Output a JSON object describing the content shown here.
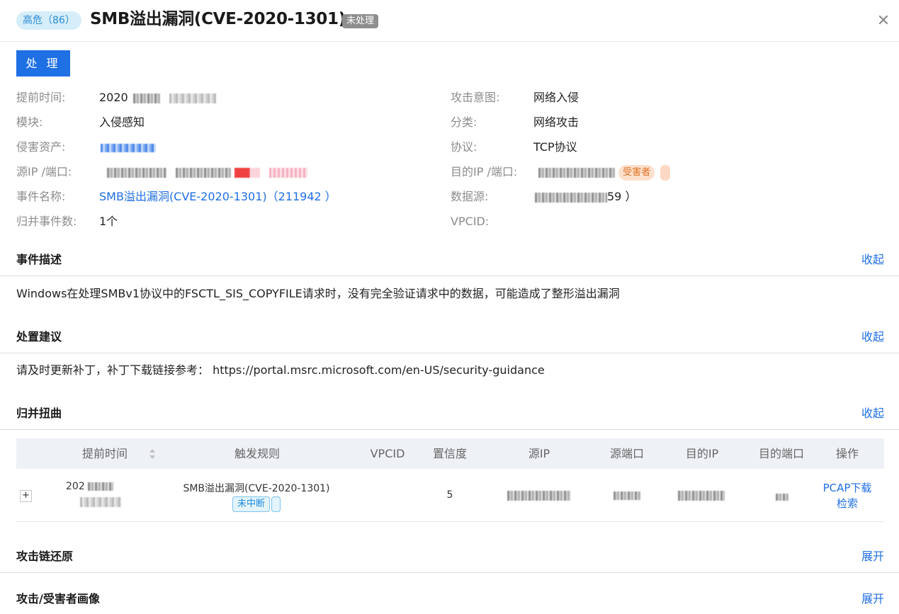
{
  "header": {
    "severity_label": "高危（86）",
    "title": "SMB溢出漏洞(CVE-2020-1301)",
    "status": "未处理",
    "close_glyph": "✕"
  },
  "handle_button": "处 理",
  "fields": {
    "alert_time_label": "提前时间:",
    "alert_time_value": "2020",
    "module_label": "模块:",
    "module_value": "入侵感知",
    "asset_label": "侵害资产:",
    "src_label": "源IP /端口:",
    "event_name_label": "事件名称:",
    "event_name_value": "SMB溢出漏洞(CVE-2020-1301)（211942 ）",
    "merged_count_label": "归并事件数:",
    "merged_count_value": "1个",
    "intent_label": "攻击意图:",
    "intent_value": "网络入侵",
    "category_label": "分类:",
    "category_value": "网络攻击",
    "protocol_label": "协议:",
    "protocol_value": "TCP协议",
    "dst_label": "目的IP /端口:",
    "victim_tag": "受害者",
    "datasource_label": "数据源:",
    "datasource_suffix": "59 ）",
    "vpcid_label": "VPCID:"
  },
  "sections": {
    "description": {
      "title": "事件描述",
      "action": "收起",
      "body": "Windows在处理SMBv1协议中的FSCTL_SIS_COPYFILE请求时，没有完全验证请求中的数据，可能造成了整形溢出漏洞"
    },
    "advice": {
      "title": "处置建议",
      "action": "收起",
      "body": "请及时更新补丁，补丁下载链接参考： https://portal.msrc.microsoft.com/en-US/security-guidance"
    },
    "merged": {
      "title": "归并扭曲",
      "action": "收起"
    },
    "attack_chain": {
      "title": "攻击链还原",
      "action": "展开"
    },
    "profile": {
      "title": "攻击/受害者画像",
      "action": "展开"
    }
  },
  "table": {
    "columns": [
      "提前时间",
      "触发规则",
      "VPCID",
      "置信度",
      "源IP",
      "源端口",
      "目的IP",
      "目的端口",
      "操作"
    ],
    "row": {
      "expand_glyph": "+",
      "time_prefix": "202",
      "rule": "SMB溢出漏洞(CVE-2020-1301)",
      "rule_tag": "未中断",
      "confidence": "5",
      "op_pcap": "PCAP下载",
      "op_search": "检索"
    }
  }
}
